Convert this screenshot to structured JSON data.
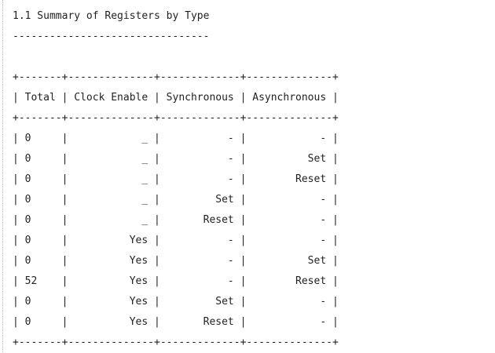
{
  "report": {
    "title": "1.1 Summary of Registers by Type",
    "underline": "--------------------------------",
    "border": "+-------+--------------+-------------+--------------+",
    "header": "| Total | Clock Enable | Synchronous | Asynchronous |",
    "rows": [
      "| 0     |            _ |           - |            - |",
      "| 0     |            _ |           - |          Set |",
      "| 0     |            _ |           - |        Reset |",
      "| 0     |            _ |         Set |            - |",
      "| 0     |            _ |       Reset |            - |",
      "| 0     |          Yes |           - |            - |",
      "| 0     |          Yes |           - |          Set |",
      "| 52    |          Yes |           - |        Reset |",
      "| 0     |          Yes |         Set |            - |",
      "| 0     |          Yes |       Reset |            - |"
    ]
  }
}
